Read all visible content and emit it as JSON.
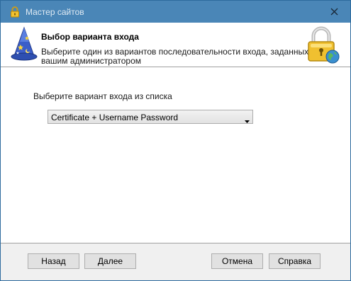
{
  "window": {
    "title": "Мастер сайтов"
  },
  "header": {
    "title": "Выбор варианта входа",
    "description": "Выберите один из вариантов последовательности входа, заданных вашим администратором"
  },
  "content": {
    "select_label": "Выберите вариант входа из списка",
    "login_variant": {
      "selected": "Certificate + Username Password"
    }
  },
  "footer": {
    "back_label": "Назад",
    "next_label": "Далее",
    "cancel_label": "Отмена",
    "help_label": "Справка"
  },
  "icons": {
    "title_icon": "lock-icon",
    "close_icon": "close-icon",
    "wizard_icon": "wizard-hat-icon",
    "header_icon": "lock-globe-icon",
    "dropdown_icon": "chevron-down-icon"
  }
}
